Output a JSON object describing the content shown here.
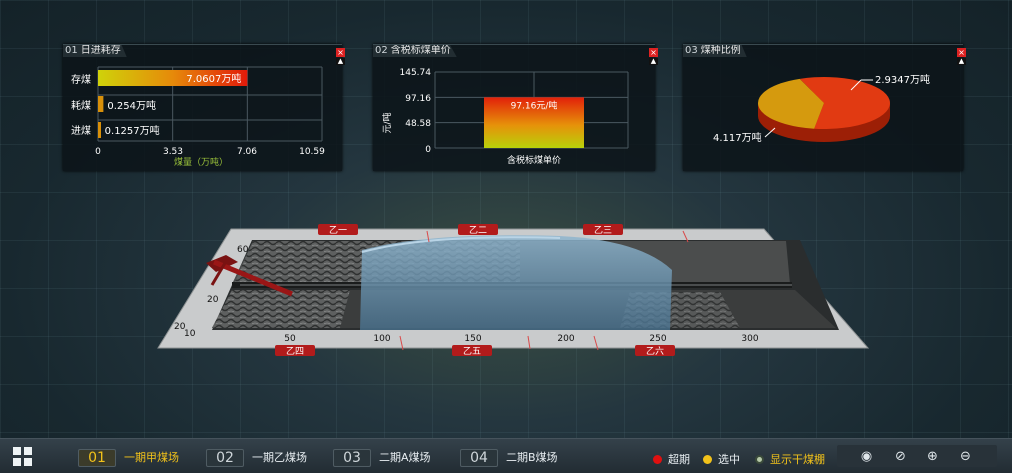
{
  "panels": {
    "daily": {
      "num": "01",
      "title": "日进耗存",
      "categories": [
        "存煤",
        "耗煤",
        "进煤"
      ],
      "values": [
        "7.0607万吨",
        "0.254万吨",
        "0.1257万吨"
      ],
      "ticks": [
        "0",
        "3.53",
        "7.06",
        "10.59"
      ],
      "xlabel": "煤量（万吨）"
    },
    "price": {
      "num": "02",
      "title": "含税标煤单价",
      "ticks": [
        "145.74",
        "97.16",
        "48.58",
        "0"
      ],
      "ylabel": "元/吨",
      "bar_label": "97.16元/吨",
      "category": "含税标煤单价"
    },
    "ratio": {
      "num": "03",
      "title": "煤种比例",
      "slice_labels": [
        "2.9347万吨",
        "4.117万吨"
      ]
    },
    "close_label": "×",
    "min_label": "▲"
  },
  "chart_data": [
    {
      "type": "bar",
      "orientation": "horizontal",
      "title": "日进耗存",
      "categories": [
        "存煤",
        "耗煤",
        "进煤"
      ],
      "values": [
        7.0607,
        0.254,
        0.1257
      ],
      "xlabel": "煤量（万吨）",
      "xlim": [
        0,
        10.59
      ],
      "grid": true
    },
    {
      "type": "bar",
      "title": "含税标煤单价",
      "categories": [
        "含税标煤单价"
      ],
      "values": [
        97.16
      ],
      "ylabel": "元/吨",
      "ylim": [
        0,
        145.74
      ],
      "grid": true
    },
    {
      "type": "pie",
      "title": "煤种比例",
      "values": [
        4.117,
        2.9347
      ],
      "colors": [
        "#e13a12",
        "#d59a0e"
      ]
    }
  ],
  "yard": {
    "labels_top": [
      "乙一",
      "乙二",
      "乙三"
    ],
    "labels_bottom": [
      "乙四",
      "乙五",
      "乙六"
    ],
    "x_ticks": [
      "50",
      "100",
      "150",
      "200",
      "250",
      "300"
    ],
    "y_ticks": [
      "60",
      "20",
      "20",
      "10"
    ]
  },
  "bottom": {
    "fields": [
      {
        "num": "01",
        "label": "一期甲煤场"
      },
      {
        "num": "02",
        "label": "一期乙煤场"
      },
      {
        "num": "03",
        "label": "二期A煤场"
      },
      {
        "num": "04",
        "label": "二期B煤场"
      }
    ],
    "legend": [
      {
        "label": "超期",
        "color": "#e01010"
      },
      {
        "label": "选中",
        "color": "#f2c21a"
      },
      {
        "label": "显示干煤棚",
        "color": "#b6c9a8"
      }
    ],
    "tools": [
      "eye-icon",
      "compass-icon",
      "zoom-in-icon",
      "zoom-out-icon"
    ]
  },
  "colors": {
    "accent": "#f2c21a",
    "label_red": "#b21b1b"
  }
}
